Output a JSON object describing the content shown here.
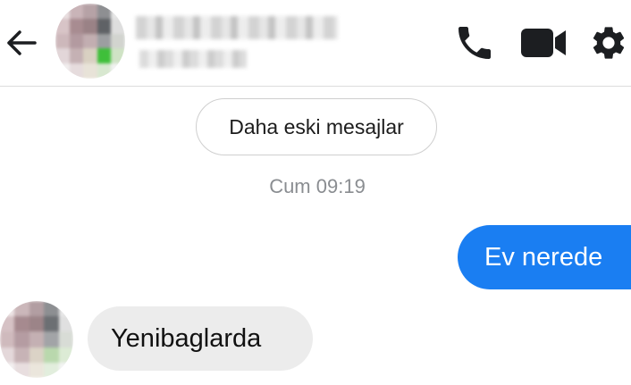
{
  "header": {
    "back_icon": "arrow-left-icon",
    "contact_avatar": "blurred",
    "contact_name": "",
    "contact_status": "",
    "actions": [
      {
        "icon": "phone-icon"
      },
      {
        "icon": "video-camera-icon"
      },
      {
        "icon": "gear-icon"
      }
    ]
  },
  "conversation": {
    "older_messages_label": "Daha eski mesajlar",
    "timestamp": "Cum 09:19",
    "messages": [
      {
        "direction": "outgoing",
        "text": "Ev nerede"
      },
      {
        "direction": "incoming",
        "text": "Yenibaglarda"
      }
    ]
  },
  "colors": {
    "accent": "#1a7ef2",
    "icon": "#1c1e21",
    "incoming_bubble": "#ececec",
    "muted_text": "#8a8d91"
  }
}
